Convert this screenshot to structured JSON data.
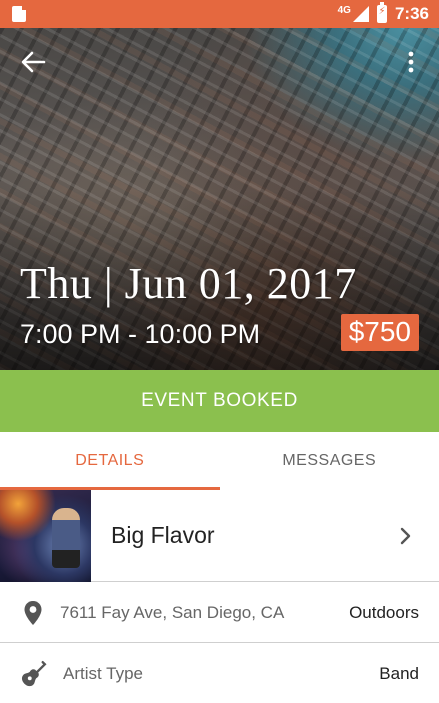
{
  "status_bar": {
    "network": "4G",
    "time": "7:36"
  },
  "event": {
    "date": "Thu | Jun 01, 2017",
    "time_range": "7:00 PM - 10:00 PM",
    "price": "$750"
  },
  "banner": {
    "label": "EVENT BOOKED"
  },
  "tabs": [
    {
      "label": "DETAILS",
      "active": true
    },
    {
      "label": "MESSAGES",
      "active": false
    }
  ],
  "artist": {
    "name": "Big Flavor"
  },
  "details": {
    "location": "7611 Fay Ave, San Diego, CA",
    "setting": "Outdoors",
    "artist_type_label": "Artist Type",
    "artist_type_value": "Band"
  },
  "colors": {
    "accent": "#e5683f",
    "booked": "#8bc04e"
  },
  "icons": {
    "back": "arrow-left-icon",
    "more": "more-vertical-icon",
    "location": "map-pin-icon",
    "artist_type": "guitar-icon",
    "chevron": "chevron-right-icon"
  }
}
